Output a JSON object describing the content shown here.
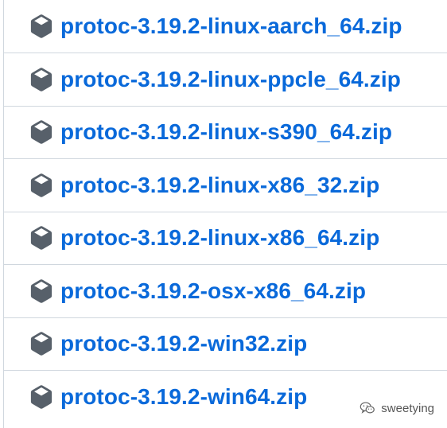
{
  "assets": [
    {
      "name": "protoc-3.19.2-linux-aarch_64.zip",
      "icon": "package-icon"
    },
    {
      "name": "protoc-3.19.2-linux-ppcle_64.zip",
      "icon": "package-icon"
    },
    {
      "name": "protoc-3.19.2-linux-s390_64.zip",
      "icon": "package-icon"
    },
    {
      "name": "protoc-3.19.2-linux-x86_32.zip",
      "icon": "package-icon"
    },
    {
      "name": "protoc-3.19.2-linux-x86_64.zip",
      "icon": "package-icon"
    },
    {
      "name": "protoc-3.19.2-osx-x86_64.zip",
      "icon": "package-icon"
    },
    {
      "name": "protoc-3.19.2-win32.zip",
      "icon": "package-icon"
    },
    {
      "name": "protoc-3.19.2-win64.zip",
      "icon": "package-icon"
    }
  ],
  "watermark": {
    "text": "sweetying",
    "icon": "wechat-icon"
  },
  "colors": {
    "link": "#0969da",
    "icon": "#57606a",
    "border": "#d0d7de"
  }
}
